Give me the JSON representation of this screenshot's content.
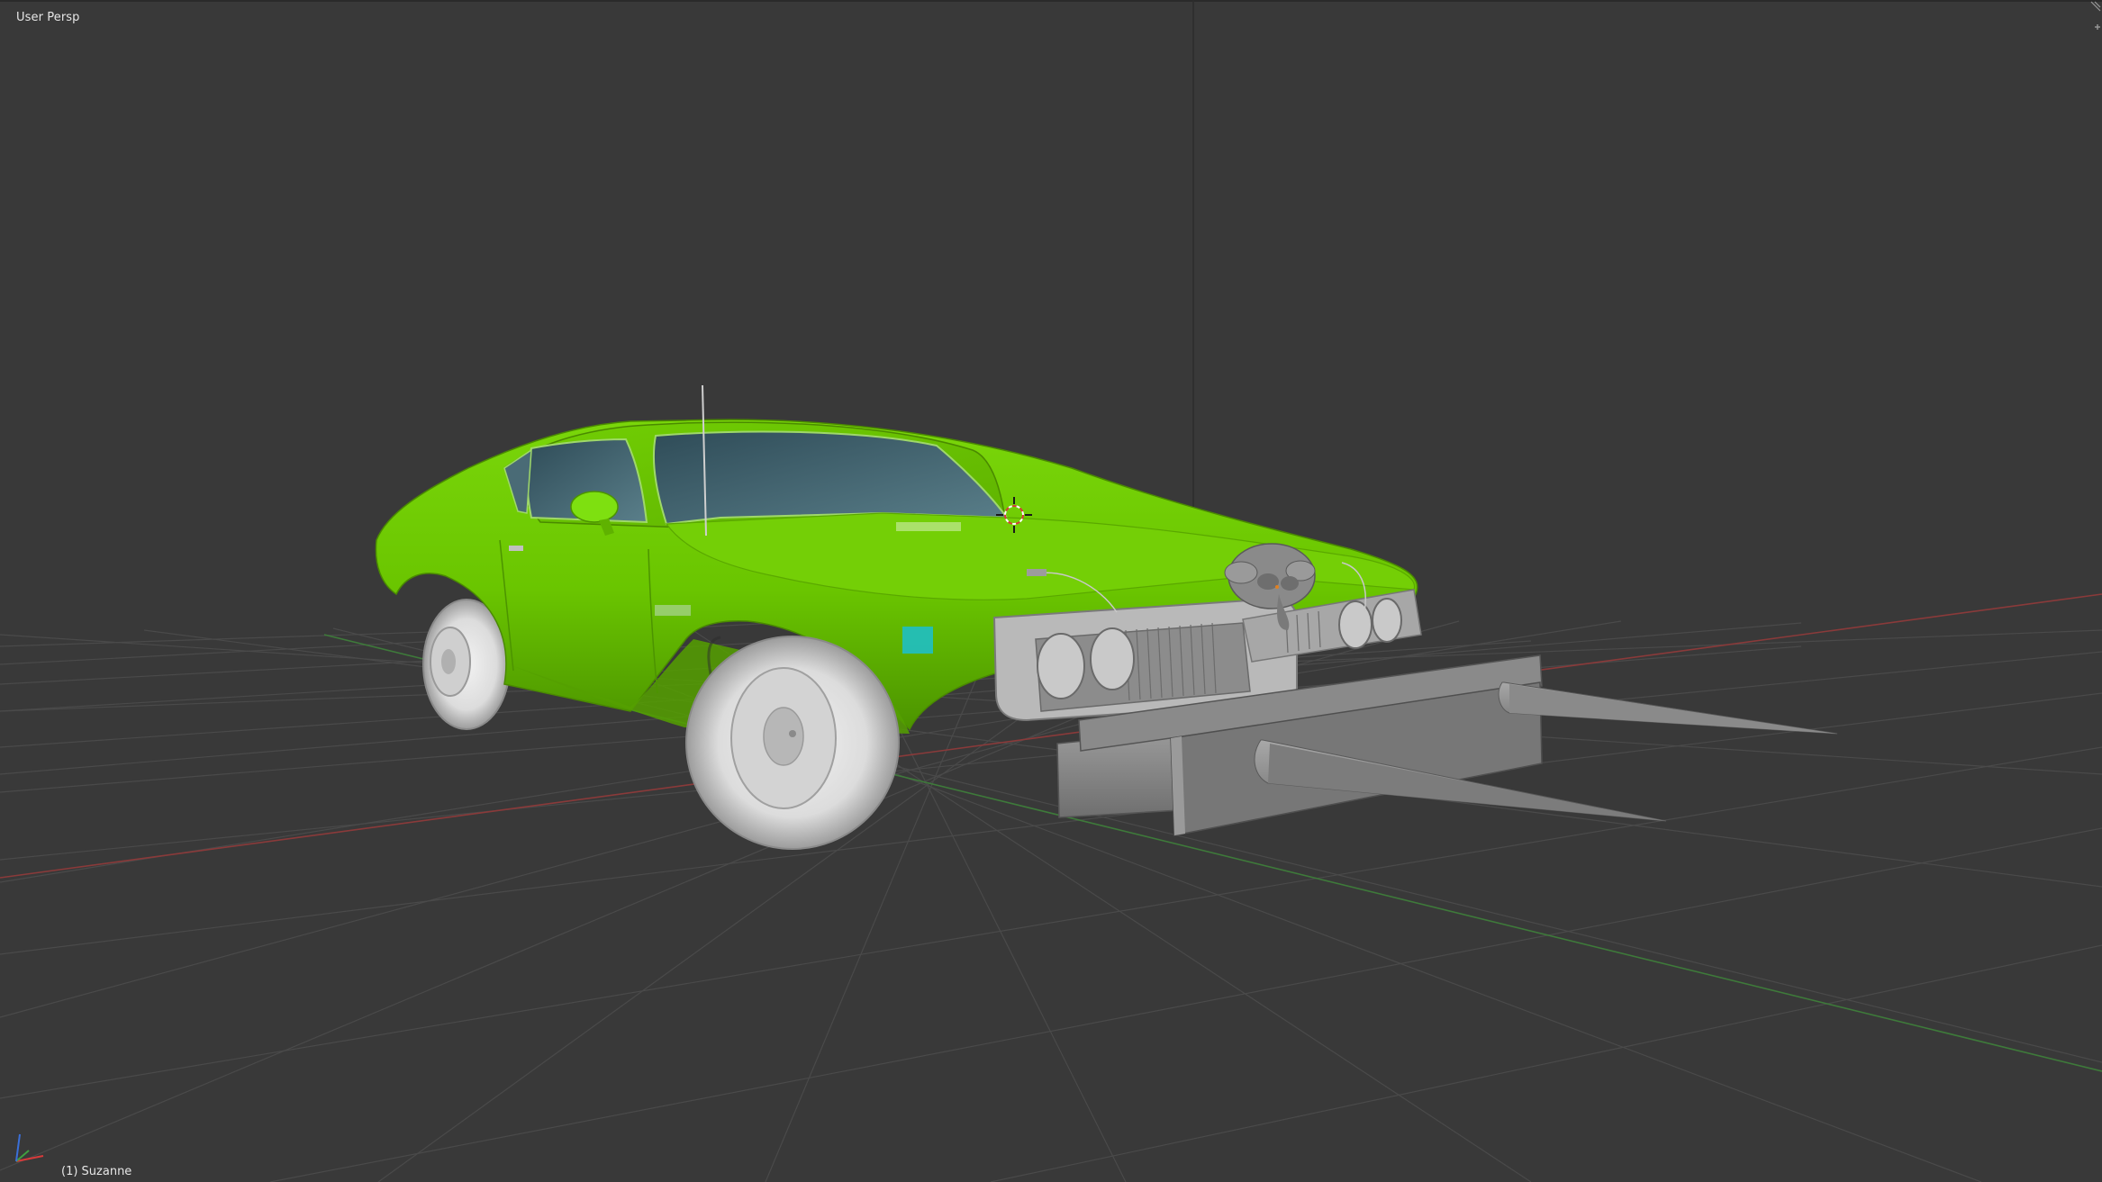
{
  "viewport": {
    "view_name": "User Persp",
    "active_object": "(1) Suzanne"
  },
  "colors": {
    "background": "#393939",
    "grid": "#4a4a4a",
    "x_axis": "#8a3a3a",
    "y_axis": "#3e7a3a",
    "car_body": "#6ac500",
    "car_body_shadow": "#4f9a00",
    "mesh_gray": "#8c8c8c",
    "glass": "#3f6270"
  },
  "icons": {
    "axis_gizmo": "axis-gizmo-icon",
    "cursor_3d": "3d-cursor-icon"
  }
}
